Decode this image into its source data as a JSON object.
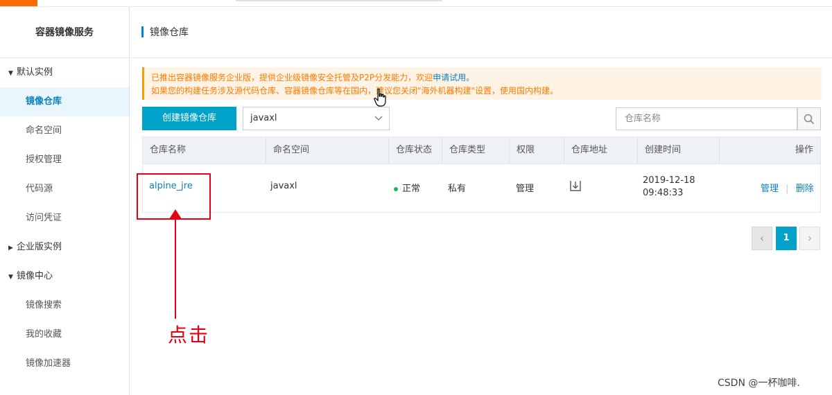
{
  "sidebar": {
    "title": "容器镜像服务",
    "groups": [
      {
        "label": "默认实例",
        "expanded": true,
        "items": [
          "镜像仓库",
          "命名空间",
          "授权管理",
          "代码源",
          "访问凭证"
        ]
      },
      {
        "label": "企业版实例",
        "expanded": false,
        "items": []
      },
      {
        "label": "镜像中心",
        "expanded": true,
        "items": [
          "镜像搜索",
          "我的收藏",
          "镜像加速器"
        ]
      }
    ],
    "active_item": "镜像仓库"
  },
  "header": {
    "title": "镜像仓库"
  },
  "notice": {
    "line1_prefix": "已推出容器镜像服务企业版，提供企业级镜像安全托管及P2P分发能力，欢迎",
    "line1_link": "申请试用。",
    "line2": "如果您的构建任务涉及源代码仓库、容器镜像仓库等在国内，建议您关闭\"海外机器构建\"设置，使用国内构建。"
  },
  "toolbar": {
    "create_button": "创建镜像仓库",
    "namespace_value": "javaxl",
    "search_placeholder": "仓库名称"
  },
  "table": {
    "columns": [
      "仓库名称",
      "命名空间",
      "仓库状态",
      "仓库类型",
      "权限",
      "仓库地址",
      "创建时间",
      "操作"
    ],
    "rows": [
      {
        "name": "alpine_jre",
        "namespace": "javaxl",
        "status": "正常",
        "type": "私有",
        "permission": "管理",
        "created_date": "2019-12-18",
        "created_time": "09:48:33",
        "action_manage": "管理",
        "action_sep": "|",
        "action_delete": "删除"
      }
    ]
  },
  "pagination": {
    "prev": "‹",
    "current": "1",
    "next": "›"
  },
  "annotation": {
    "text": "点击"
  },
  "watermark": "CSDN @一杯咖啡.",
  "colors": {
    "accent": "#00a2ca",
    "link": "#0b7fc1",
    "annotation": "#e60012",
    "notice_text": "#ff7a00",
    "status_ok": "#1cb55b"
  }
}
